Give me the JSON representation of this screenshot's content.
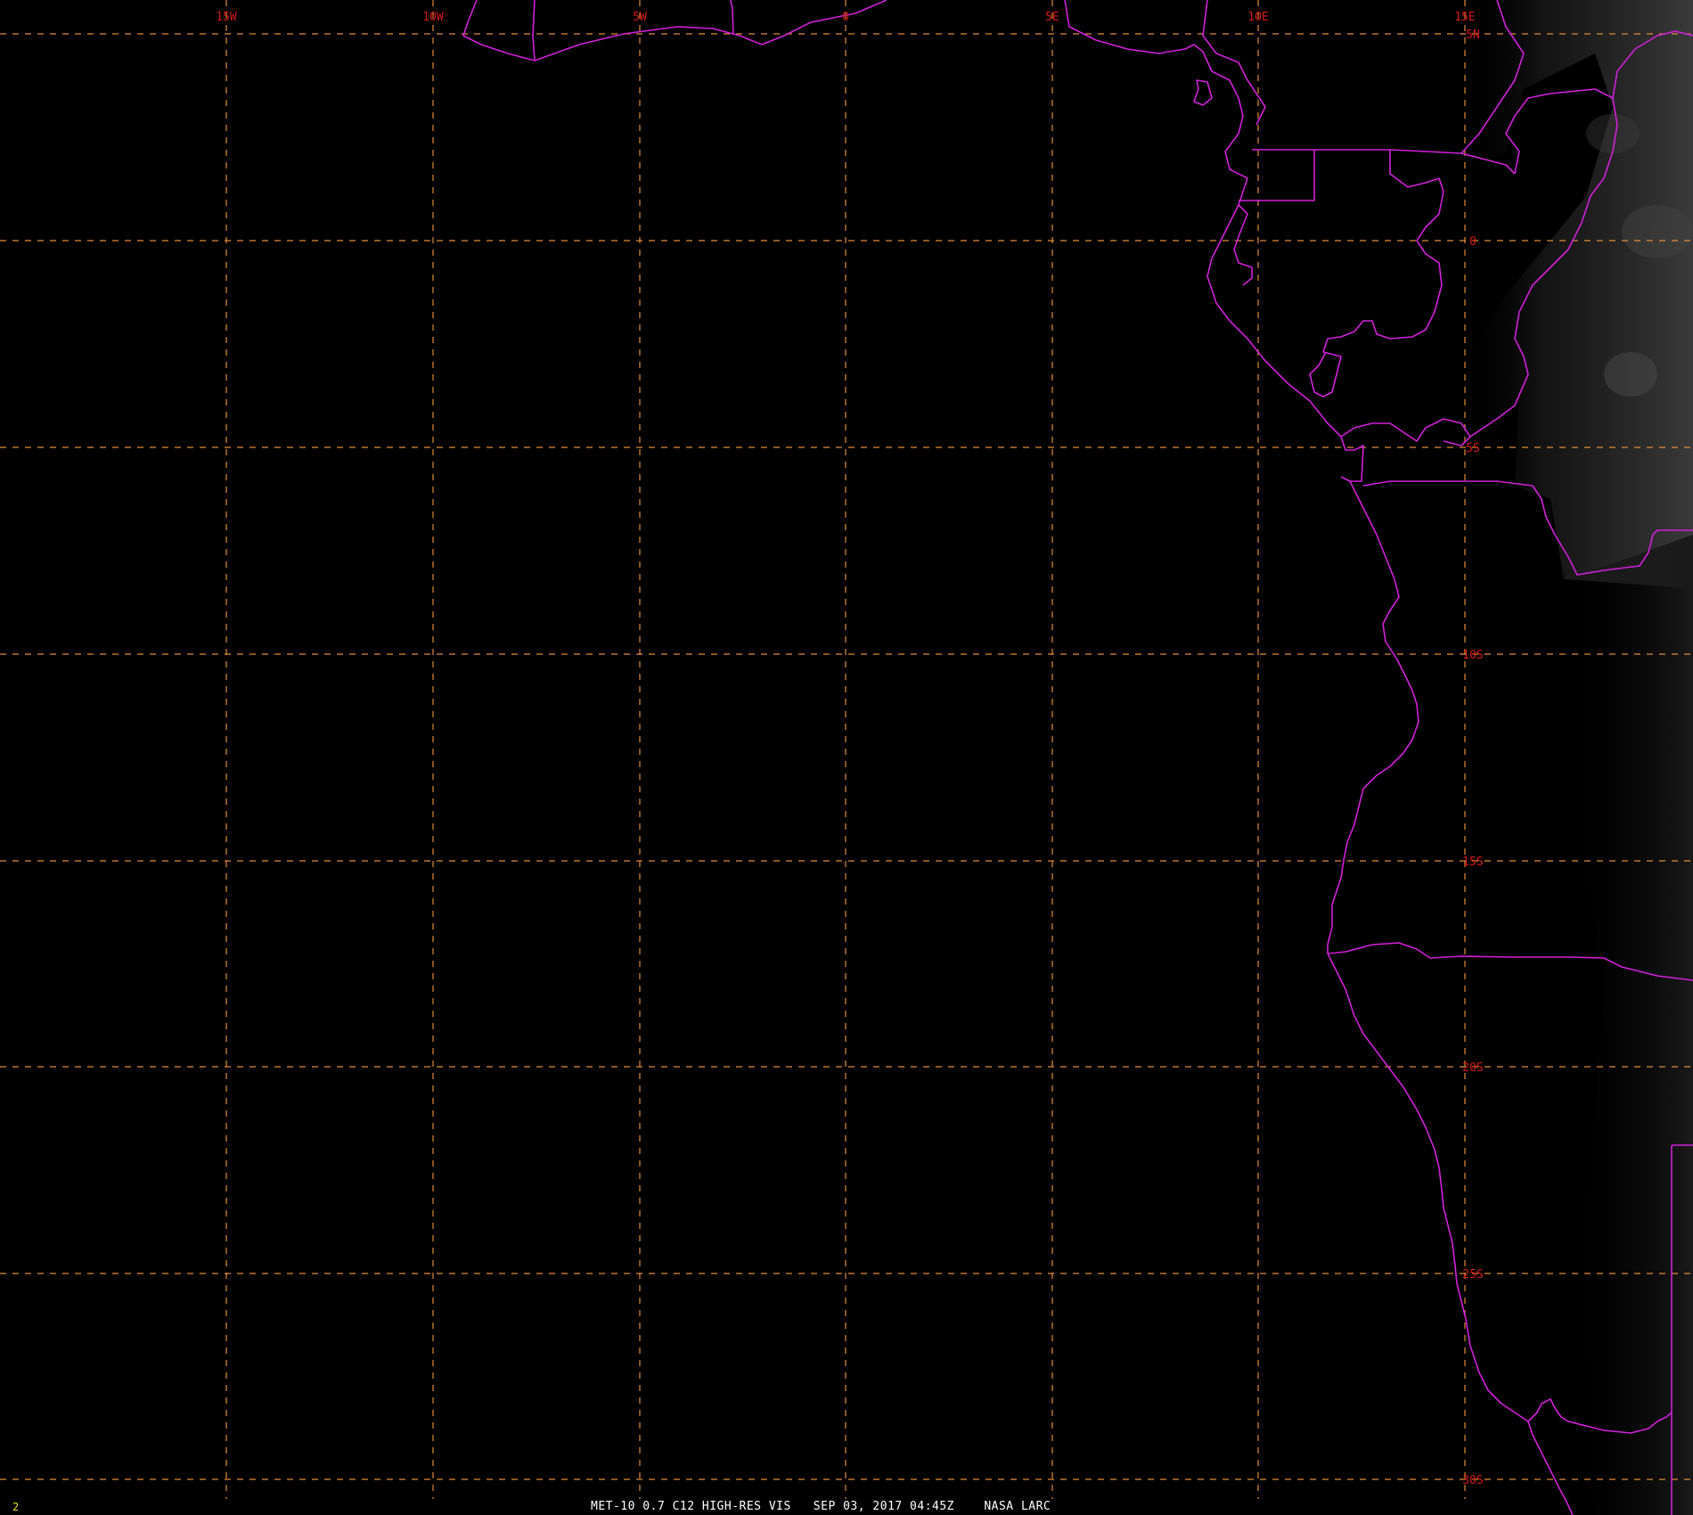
{
  "image": {
    "frame_number": "2",
    "caption": "MET-10 0.7 C12 HIGH-RES VIS   SEP 03, 2017 04:45Z    NASA LARC"
  },
  "grid": {
    "line_color": "#e08a3c",
    "label_color": "#d41818",
    "longitude_labels": [
      "15W",
      "10W",
      "5W",
      "0",
      "5E",
      "10E",
      "15E"
    ],
    "latitude_labels": [
      "5N",
      "0",
      "5S",
      "10S",
      "15S",
      "20S",
      "25S",
      "30S"
    ]
  },
  "map": {
    "background": "#000000",
    "boundary_color": "#d020d8",
    "features": [
      "coastline-icon",
      "country-border-icon",
      "cloud-cover-icon"
    ]
  }
}
